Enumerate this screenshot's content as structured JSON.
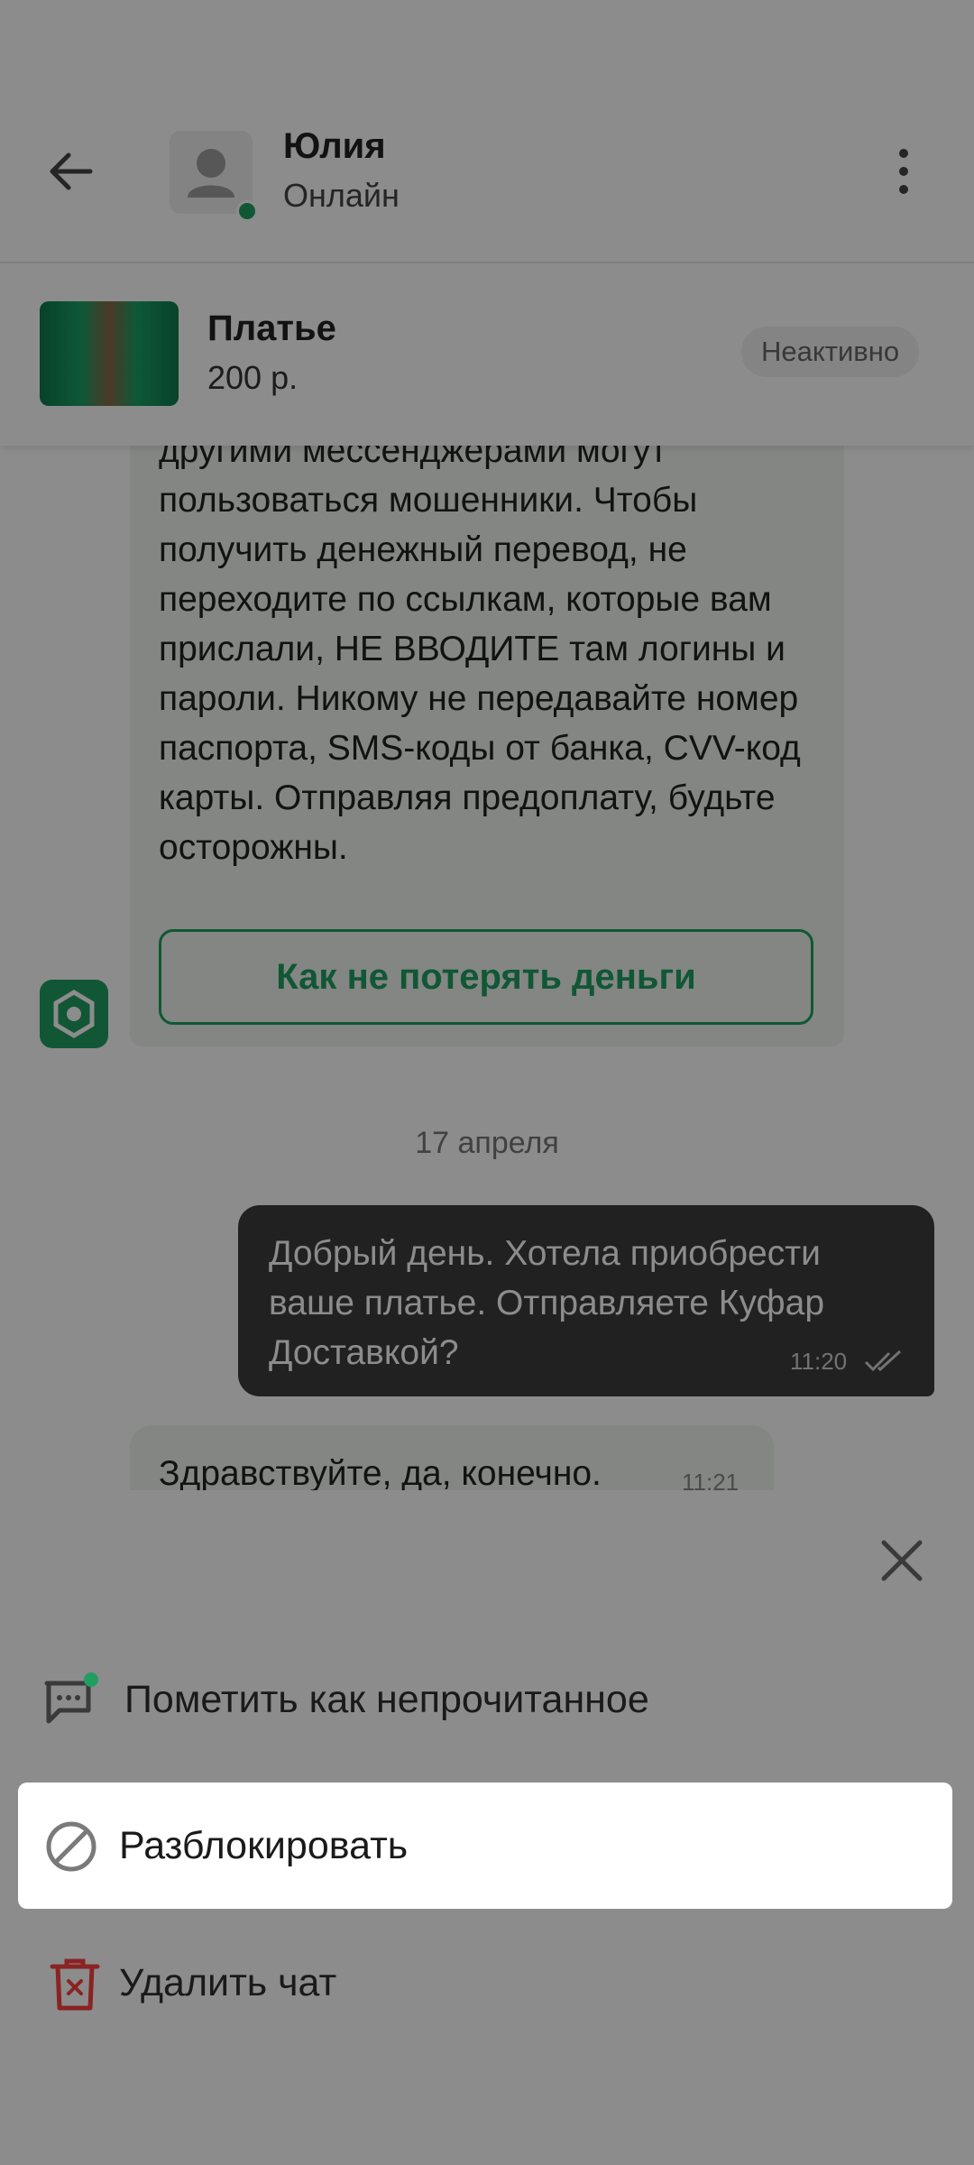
{
  "header": {
    "name": "Юлия",
    "status": "Онлайн"
  },
  "ad": {
    "title": "Платье",
    "price": "200 р.",
    "badge": "Неактивно"
  },
  "system_message": {
    "text_visible": "другими мессенджерами могут пользоваться мошенники. Чтобы получить денежный перевод, не переходите по ссылкам, которые вам прислали, НЕ ВВОДИТЕ там логины и пароли. Никому не передавайте номер паспорта, SMS-коды от банка, CVV-код карты. Отправляя предоплату, будьте осторожны.",
    "button": "Как не потерять деньги"
  },
  "date_separator": "17 апреля",
  "messages": [
    {
      "direction": "out",
      "text": "Добрый день. Хотела приобрести ваше платье. Отправляете Куфар Доставкой?",
      "time": "11:20"
    },
    {
      "direction": "in",
      "text": "Здравствуйте, да, конечно.",
      "time": "11:21"
    }
  ],
  "sheet": {
    "items": [
      {
        "label": "Пометить как непрочитанное",
        "icon": "chat-unread-icon"
      },
      {
        "label": "Разблокировать",
        "icon": "block-icon"
      },
      {
        "label": "Удалить чат",
        "icon": "trash-icon"
      }
    ]
  },
  "colors": {
    "accent": "#1f9e62",
    "danger": "#c0392b",
    "scrim": "rgba(0,0,0,0.45)"
  }
}
